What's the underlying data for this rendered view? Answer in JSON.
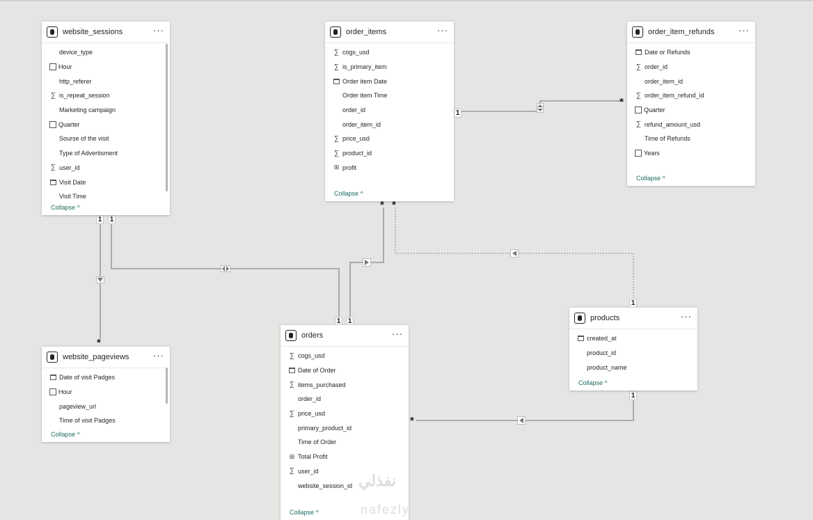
{
  "tables": {
    "website_sessions": {
      "title": "website_sessions",
      "fields": [
        {
          "label": "device_type",
          "icon": "none"
        },
        {
          "label": "Hour",
          "icon": "hierarchy-icon"
        },
        {
          "label": "http_referer",
          "icon": "none"
        },
        {
          "label": "is_repeat_session",
          "icon": "sigma-icon"
        },
        {
          "label": "Marketing campaign",
          "icon": "none"
        },
        {
          "label": "Quarter",
          "icon": "hierarchy-icon"
        },
        {
          "label": "Sourse of the visit",
          "icon": "none"
        },
        {
          "label": "Type of Advertisment",
          "icon": "none"
        },
        {
          "label": "user_id",
          "icon": "sigma-icon"
        },
        {
          "label": "Visit Date",
          "icon": "calendar-icon"
        },
        {
          "label": "Visit Time",
          "icon": "none"
        }
      ],
      "collapse": "Collapse ^"
    },
    "order_items": {
      "title": "order_items",
      "fields": [
        {
          "label": "cogs_usd",
          "icon": "sigma-icon"
        },
        {
          "label": "is_primary_item",
          "icon": "sigma-icon"
        },
        {
          "label": "Order item Date",
          "icon": "calendar-icon"
        },
        {
          "label": "Order item Time",
          "icon": "none"
        },
        {
          "label": "order_id",
          "icon": "none"
        },
        {
          "label": "order_item_id",
          "icon": "none"
        },
        {
          "label": "price_usd",
          "icon": "sigma-icon"
        },
        {
          "label": "product_id",
          "icon": "sigma-icon"
        },
        {
          "label": "profit",
          "icon": "calculator-icon"
        }
      ],
      "collapse": "Collapse ^"
    },
    "order_item_refunds": {
      "title": "order_item_refunds",
      "fields": [
        {
          "label": "Date or Refunds",
          "icon": "calendar-icon"
        },
        {
          "label": "order_id",
          "icon": "sigma-icon"
        },
        {
          "label": "order_item_id",
          "icon": "none"
        },
        {
          "label": "order_item_refund_id",
          "icon": "sigma-icon"
        },
        {
          "label": "Quarter",
          "icon": "hierarchy-icon"
        },
        {
          "label": "refund_amount_usd",
          "icon": "sigma-icon"
        },
        {
          "label": "Time of Refunds",
          "icon": "none"
        },
        {
          "label": "Years",
          "icon": "hierarchy-icon"
        }
      ],
      "collapse": "Collapse ^"
    },
    "website_pageviews": {
      "title": "website_pageviews",
      "fields": [
        {
          "label": "Date of visit Padges",
          "icon": "calendar-icon"
        },
        {
          "label": "Hour",
          "icon": "hierarchy-icon"
        },
        {
          "label": "pageview_url",
          "icon": "none"
        },
        {
          "label": "Time of visit Padges",
          "icon": "none"
        }
      ],
      "collapse": "Collapse ^"
    },
    "orders": {
      "title": "orders",
      "fields": [
        {
          "label": "cogs_usd",
          "icon": "sigma-icon"
        },
        {
          "label": "Date of Order",
          "icon": "calendar-icon"
        },
        {
          "label": "items_purchased",
          "icon": "sigma-icon"
        },
        {
          "label": "order_id",
          "icon": "none"
        },
        {
          "label": "price_usd",
          "icon": "sigma-icon"
        },
        {
          "label": "primary_product_id",
          "icon": "none"
        },
        {
          "label": "Time of Order",
          "icon": "none"
        },
        {
          "label": "Total Profit",
          "icon": "calculator-icon"
        },
        {
          "label": "user_id",
          "icon": "sigma-icon"
        },
        {
          "label": "website_session_id",
          "icon": "none"
        }
      ],
      "collapse": "Collapse ^"
    },
    "products": {
      "title": "products",
      "fields": [
        {
          "label": "created_at",
          "icon": "calendar-icon"
        },
        {
          "label": "product_id",
          "icon": "none"
        },
        {
          "label": "product_name",
          "icon": "none"
        }
      ],
      "collapse": "Collapse ^"
    }
  },
  "cardinality": {
    "one": "1",
    "many": "*"
  },
  "watermark": {
    "arabic": "نفذلي",
    "latin": "nafezly"
  }
}
